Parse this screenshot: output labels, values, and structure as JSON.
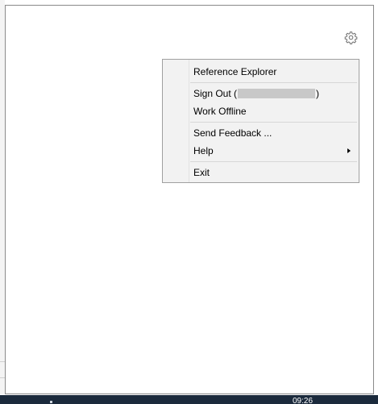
{
  "menu": {
    "items": {
      "reference_explorer": "Reference Explorer",
      "sign_out_prefix": "Sign Out (",
      "sign_out_suffix": ")",
      "work_offline": "Work Offline",
      "send_feedback": "Send Feedback ...",
      "help": "Help",
      "exit": "Exit"
    }
  },
  "taskbar": {
    "clock": "09:26"
  },
  "icons": {
    "settings": "gear-icon",
    "submenu": "chevron-right-icon"
  },
  "colors": {
    "menu_background": "#f2f2f2",
    "menu_border": "#a0a0a0",
    "taskbar": "#1b2a3c"
  }
}
